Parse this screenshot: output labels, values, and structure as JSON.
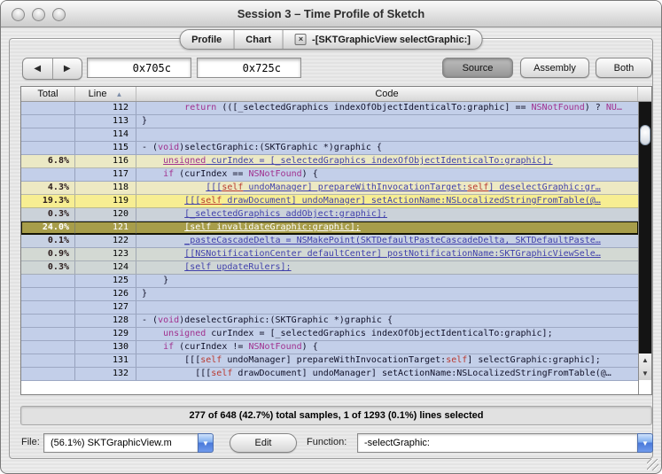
{
  "window": {
    "title": "Session 3 – Time Profile of Sketch"
  },
  "tabs": [
    {
      "label": "Profile"
    },
    {
      "label": "Chart"
    },
    {
      "label": "-[SKTGraphicView selectGraphic:]",
      "closable": true
    }
  ],
  "toolbar": {
    "address_start": "0x705c",
    "address_end": "0x725c",
    "view_buttons": [
      "Source",
      "Assembly",
      "Both"
    ],
    "selected_view": "Source"
  },
  "table": {
    "headers": {
      "total": "Total",
      "line": "Line",
      "code": "Code"
    },
    "sort": "line-ascending",
    "rows": [
      {
        "total": "",
        "line": "112",
        "segments": [
          {
            "c": "p",
            "t": "        "
          },
          {
            "c": "k",
            "t": "return"
          },
          {
            "c": "p",
            "t": " (([_selectedGraphics indexOfObjectIdenticalTo:graphic] == "
          },
          {
            "c": "k",
            "t": "NSNotFound"
          },
          {
            "c": "p",
            "t": ") ? "
          },
          {
            "c": "k",
            "t": "NU…"
          }
        ]
      },
      {
        "total": "",
        "line": "113",
        "segments": [
          {
            "c": "p",
            "t": "}"
          }
        ]
      },
      {
        "total": "",
        "line": "114",
        "segments": []
      },
      {
        "total": "",
        "line": "115",
        "segments": [
          {
            "c": "p",
            "t": "- ("
          },
          {
            "c": "k",
            "t": "void"
          },
          {
            "c": "p",
            "t": ")selectGraphic:(SKTGraphic *)graphic {"
          }
        ]
      },
      {
        "total": "6.8%",
        "line": "116",
        "bg": "#ebe9c5",
        "segments": [
          {
            "c": "p",
            "t": "    "
          },
          {
            "c": "k",
            "t": "unsigned",
            "u": 1
          },
          {
            "c": "l",
            "t": " curIndex = [_selectedGraphics indexOfObjectIdenticalTo:graphic];",
            "u": 1
          }
        ]
      },
      {
        "total": "",
        "line": "117",
        "segments": [
          {
            "c": "p",
            "t": "    "
          },
          {
            "c": "k",
            "t": "if"
          },
          {
            "c": "p",
            "t": " (curIndex == "
          },
          {
            "c": "k",
            "t": "NSNotFound"
          },
          {
            "c": "p",
            "t": ") {"
          }
        ]
      },
      {
        "total": "4.3%",
        "line": "118",
        "bg": "#ede9c3",
        "segments": [
          {
            "c": "p",
            "t": "            "
          },
          {
            "c": "l",
            "t": "[[[",
            "u": 1
          },
          {
            "c": "r",
            "t": "self",
            "u": 1
          },
          {
            "c": "l",
            "t": " undoManager] prepareWithInvocationTarget:",
            "u": 1
          },
          {
            "c": "r",
            "t": "self",
            "u": 1
          },
          {
            "c": "l",
            "t": "] deselectGraphic:gr…",
            "u": 1
          }
        ]
      },
      {
        "total": "19.3%",
        "line": "119",
        "bg": "#f7ee92",
        "segments": [
          {
            "c": "p",
            "t": "        "
          },
          {
            "c": "l",
            "t": "[[[",
            "u": 1
          },
          {
            "c": "r",
            "t": "self",
            "u": 1
          },
          {
            "c": "l",
            "t": " drawDocument] undoManager] setActionName:NSLocalizedStringFromTable(@…",
            "u": 1
          }
        ]
      },
      {
        "total": "0.3%",
        "line": "120",
        "bg": "#cbd2d9",
        "segments": [
          {
            "c": "p",
            "t": "        "
          },
          {
            "c": "l",
            "t": "[_selectedGraphics addObject:graphic];",
            "u": 1
          }
        ]
      },
      {
        "total": "24.0%",
        "line": "121",
        "bg": "#a79d4a",
        "selected": true,
        "segments": [
          {
            "c": "p",
            "t": "        "
          },
          {
            "c": "w",
            "t": "[self invalidateGraphic:graphic];",
            "u": 1
          }
        ]
      },
      {
        "total": "0.1%",
        "line": "122",
        "bg": "#c7d1e3",
        "segments": [
          {
            "c": "p",
            "t": "        "
          },
          {
            "c": "l",
            "t": "_pasteCascadeDelta = NSMakePoint(SKTDefaultPasteCascadeDelta, SKTDefaultPaste…",
            "u": 1
          }
        ]
      },
      {
        "total": "0.9%",
        "line": "123",
        "bg": "#d3d9d3",
        "segments": [
          {
            "c": "p",
            "t": "        "
          },
          {
            "c": "l",
            "t": "[[NSNotificationCenter defaultCenter] postNotificationName:SKTGraphicViewSele…",
            "u": 1
          }
        ]
      },
      {
        "total": "0.3%",
        "line": "124",
        "bg": "#cfd6d5",
        "segments": [
          {
            "c": "p",
            "t": "        "
          },
          {
            "c": "l",
            "t": "[self updateRulers];",
            "u": 1
          }
        ]
      },
      {
        "total": "",
        "line": "125",
        "segments": [
          {
            "c": "p",
            "t": "    }"
          }
        ]
      },
      {
        "total": "",
        "line": "126",
        "segments": [
          {
            "c": "p",
            "t": "}"
          }
        ]
      },
      {
        "total": "",
        "line": "127",
        "segments": []
      },
      {
        "total": "",
        "line": "128",
        "segments": [
          {
            "c": "p",
            "t": "- ("
          },
          {
            "c": "k",
            "t": "void"
          },
          {
            "c": "p",
            "t": ")deselectGraphic:(SKTGraphic *)graphic {"
          }
        ]
      },
      {
        "total": "",
        "line": "129",
        "segments": [
          {
            "c": "p",
            "t": "    "
          },
          {
            "c": "k",
            "t": "unsigned"
          },
          {
            "c": "p",
            "t": " curIndex = [_selectedGraphics indexOfObjectIdenticalTo:graphic];"
          }
        ]
      },
      {
        "total": "",
        "line": "130",
        "segments": [
          {
            "c": "p",
            "t": "    "
          },
          {
            "c": "k",
            "t": "if"
          },
          {
            "c": "p",
            "t": " (curIndex != "
          },
          {
            "c": "k",
            "t": "NSNotFound"
          },
          {
            "c": "p",
            "t": ") {"
          }
        ]
      },
      {
        "total": "",
        "line": "131",
        "segments": [
          {
            "c": "p",
            "t": "        [[["
          },
          {
            "c": "r",
            "t": "self"
          },
          {
            "c": "p",
            "t": " undoManager] prepareWithInvocationTarget:"
          },
          {
            "c": "r",
            "t": "self"
          },
          {
            "c": "p",
            "t": "] selectGraphic:graphic];"
          }
        ]
      },
      {
        "total": "",
        "line": "132",
        "segments": [
          {
            "c": "p",
            "t": "          [[["
          },
          {
            "c": "r",
            "t": "self"
          },
          {
            "c": "p",
            "t": " drawDocument] undoManager] setActionName:NSLocalizedStringFromTable(@…"
          }
        ]
      }
    ]
  },
  "status_bar": {
    "text": "277 of 648 (42.7%) total samples, 1 of 1293 (0.1%) lines selected"
  },
  "footer": {
    "file_label": "File:",
    "file_value": "(56.1%) SKTGraphicView.m",
    "edit_label": "Edit",
    "function_label": "Function:",
    "function_value": "-selectGraphic:"
  },
  "colors": {
    "row_default": "#c3cfe9",
    "row_selected": "#a79d4a",
    "hot_yellow": "#f7ee92",
    "keyword": "#a0308e",
    "link": "#4040ab",
    "combo_accent": "#4a79da"
  }
}
